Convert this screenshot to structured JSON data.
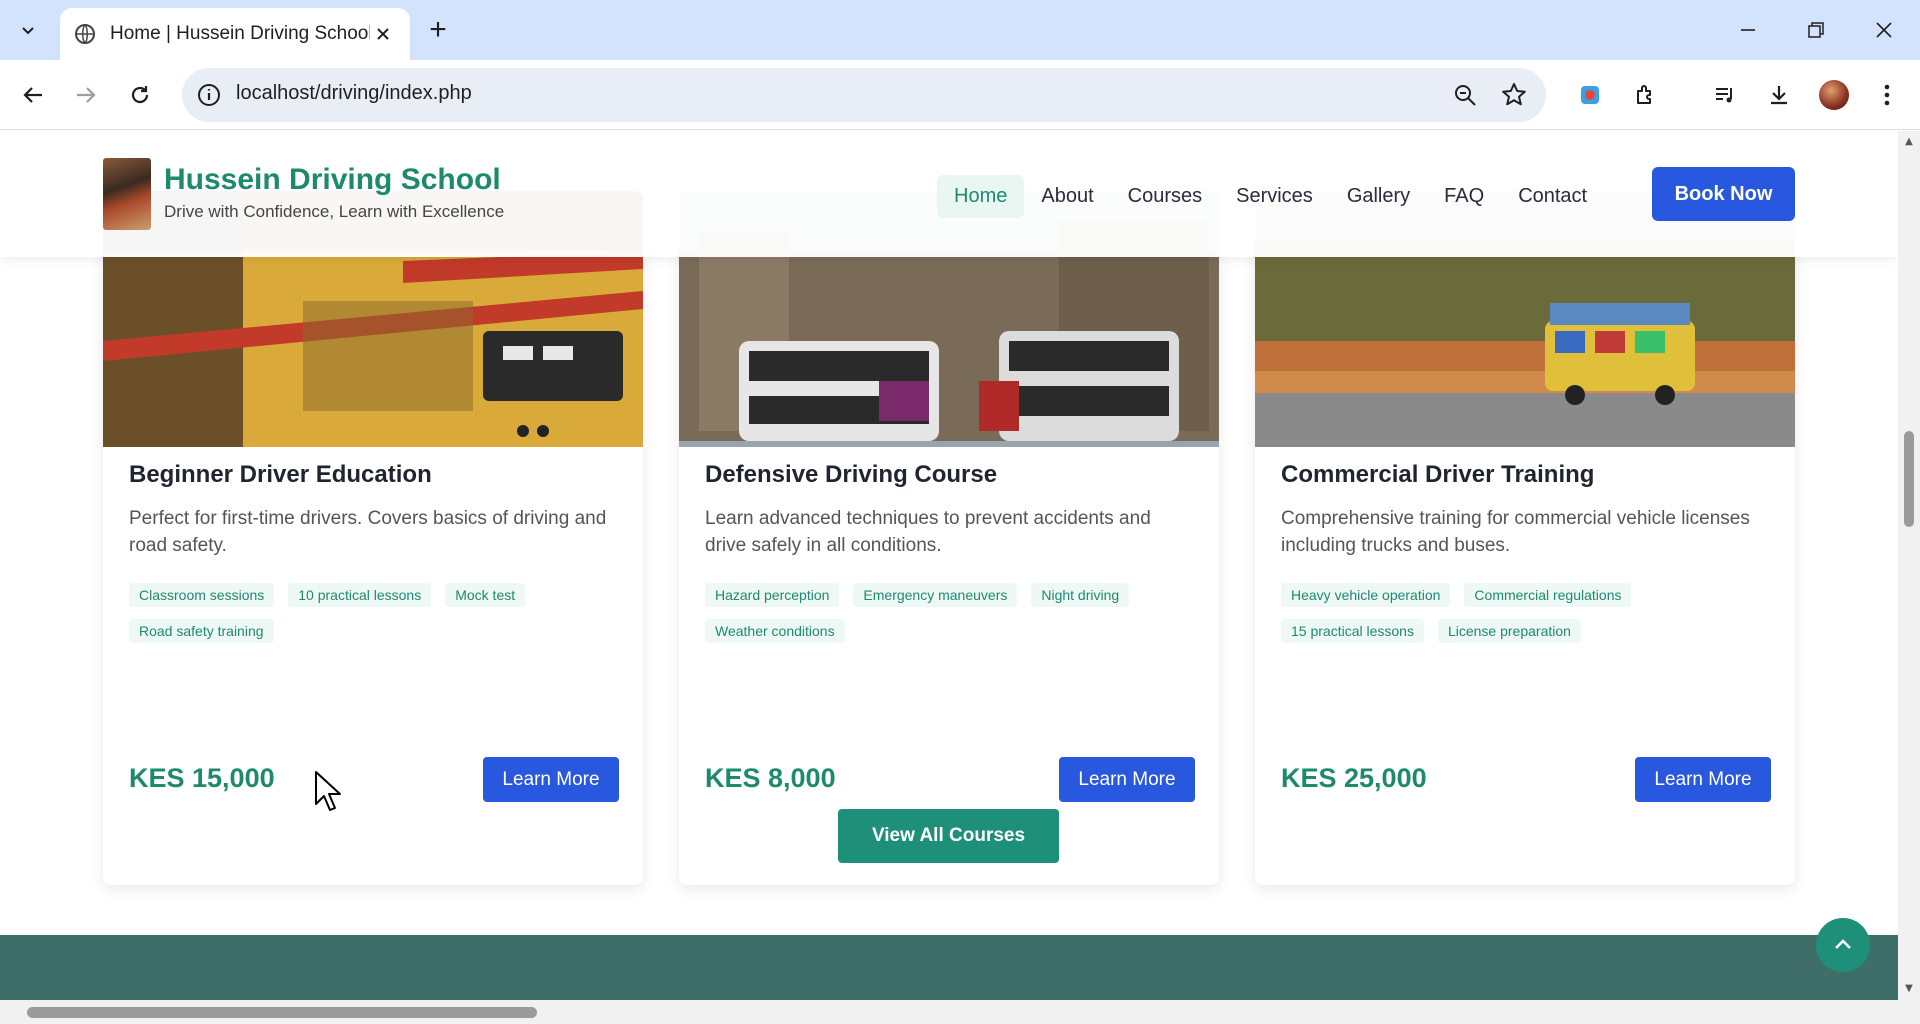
{
  "browser": {
    "tab_title": "Home | Hussein Driving School",
    "new_tab": "+",
    "url": "localhost/driving/index.php"
  },
  "site": {
    "brand": "Hussein Driving School",
    "tagline": "Drive with Confidence, Learn with Excellence",
    "nav": [
      "Home",
      "About",
      "Courses",
      "Services",
      "Gallery",
      "FAQ",
      "Contact"
    ],
    "active_nav": "Home",
    "book_now": "Book Now"
  },
  "courses": [
    {
      "title": "Beginner Driver Education",
      "description": "Perfect for first-time drivers. Covers basics of driving and road safety.",
      "tags": [
        "Classroom sessions",
        "10 practical lessons",
        "Mock test",
        "Road safety training"
      ],
      "price": "KES 15,000",
      "cta": "Learn More"
    },
    {
      "title": "Defensive Driving Course",
      "description": "Learn advanced techniques to prevent accidents and drive safely in all conditions.",
      "tags": [
        "Hazard perception",
        "Emergency maneuvers",
        "Night driving",
        "Weather conditions"
      ],
      "price": "KES 8,000",
      "cta": "Learn More"
    },
    {
      "title": "Commercial Driver Training",
      "description": "Comprehensive training for commercial vehicle licenses including trucks and buses.",
      "tags": [
        "Heavy vehicle operation",
        "Commercial regulations",
        "15 practical lessons",
        "License preparation"
      ],
      "price": "KES 25,000",
      "cta": "Learn More"
    }
  ],
  "view_all": "View All Courses",
  "colors": {
    "brand_green": "#1e8a6d",
    "button_blue": "#2858e0",
    "footer_band": "#3f6e68"
  }
}
